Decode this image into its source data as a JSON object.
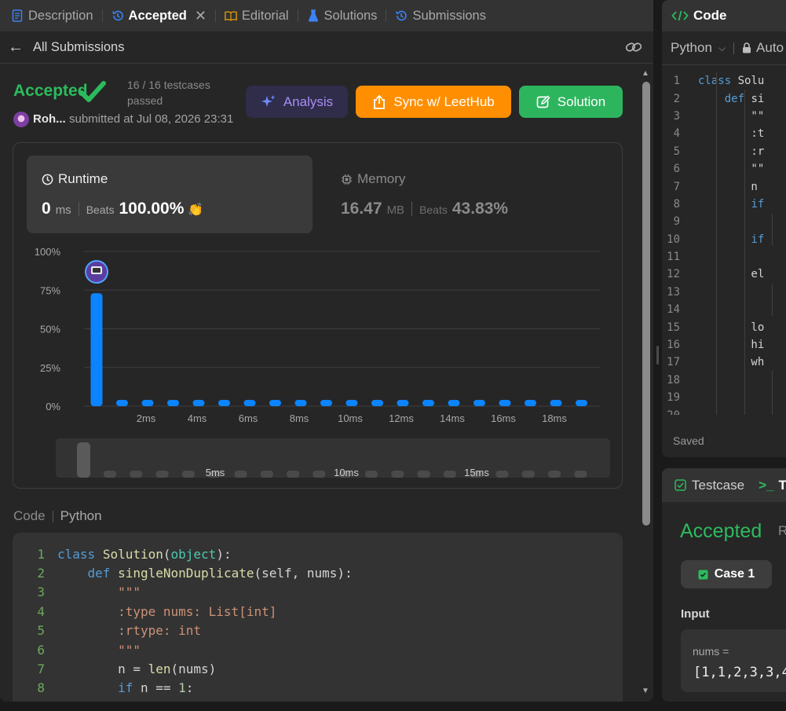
{
  "tabs": [
    {
      "label": "Description",
      "icon": "description-icon",
      "active": false
    },
    {
      "label": "Accepted",
      "icon": "history-icon",
      "active": true
    },
    {
      "label": "Editorial",
      "icon": "book-icon",
      "active": false
    },
    {
      "label": "Solutions",
      "icon": "flask-icon",
      "active": false
    },
    {
      "label": "Submissions",
      "icon": "history-icon",
      "active": false
    }
  ],
  "subbar": {
    "back_label": "All Submissions"
  },
  "result": {
    "status": "Accepted",
    "testcases": "16 / 16 testcases passed",
    "username": "Roh...",
    "submitted": "submitted at Jul 08, 2026 23:31"
  },
  "buttons": {
    "analysis": "Analysis",
    "sync": "Sync w/ LeetHub",
    "solution": "Solution"
  },
  "runtime": {
    "title": "Runtime",
    "value": "0",
    "unit": "ms",
    "beats_label": "Beats",
    "beats": "100.00%"
  },
  "memory": {
    "title": "Memory",
    "value": "16.47",
    "unit": "MB",
    "beats_label": "Beats",
    "beats": "43.83%"
  },
  "colors": {
    "accent_green": "#2cbb5d",
    "bar_blue": "#0a84ff",
    "sync_orange": "#ff8f00",
    "analysis_purple": "#a98ef5"
  },
  "chart_data": {
    "type": "bar",
    "y_ticks": [
      "100%",
      "75%",
      "50%",
      "25%",
      "0%"
    ],
    "ylim": [
      0,
      100
    ],
    "x_tick_labels": [
      "2ms",
      "4ms",
      "6ms",
      "8ms",
      "10ms",
      "12ms",
      "14ms",
      "16ms",
      "18ms"
    ],
    "categories": [
      "0ms",
      "1ms",
      "2ms",
      "3ms",
      "4ms",
      "5ms",
      "6ms",
      "7ms",
      "8ms",
      "9ms",
      "10ms",
      "11ms",
      "12ms",
      "13ms",
      "14ms",
      "15ms",
      "16ms",
      "17ms",
      "18ms",
      "19ms"
    ],
    "values": [
      73,
      0.5,
      0.5,
      0.5,
      0.5,
      0.5,
      0.5,
      0.5,
      0.5,
      0.5,
      0.5,
      0.5,
      0.5,
      0.5,
      0.5,
      0.5,
      0.5,
      0.5,
      0.5,
      0.5
    ],
    "selected_index": 0,
    "overview_labels": [
      "5ms",
      "10ms",
      "15ms"
    ]
  },
  "code_section": {
    "label": "Code",
    "language": "Python"
  },
  "code_lines": [
    "class Solution(object):",
    "    def singleNonDuplicate(self, nums):",
    "        \"\"\"",
    "        :type nums: List[int]",
    "        :rtype: int",
    "        \"\"\"",
    "        n = len(nums)",
    "        if n == 1:"
  ],
  "editor": {
    "title": "Code",
    "language": "Python",
    "auto_label": "Auto",
    "status": "Saved",
    "lines": [
      "class Solu",
      "    def si",
      "        \"\"",
      "        :t",
      "        :r",
      "        \"\"",
      "        n ",
      "        if",
      "",
      "        if",
      "",
      "        el",
      "",
      "",
      "        lo",
      "        hi",
      "        wh",
      "",
      "",
      ""
    ]
  },
  "testcase_panel": {
    "tab1": "Testcase",
    "tab2": "T",
    "status": "Accepted",
    "runtime_prefix": "R",
    "case_label": "Case 1",
    "input_label": "Input",
    "input_var": "nums =",
    "input_value": "[1,1,2,3,3,4"
  }
}
